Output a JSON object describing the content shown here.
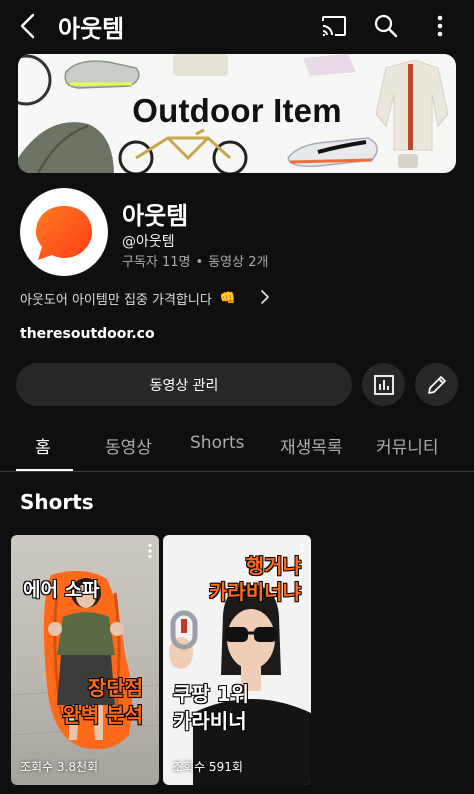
{
  "header": {
    "title": "아웃템"
  },
  "banner": {
    "text": "Outdoor Item"
  },
  "channel": {
    "name": "아웃템",
    "handle": "@아웃템",
    "subscribers": "구독자 11명",
    "separator": "•",
    "videos": "동영상 2개",
    "description": "아웃도어 아이템만 집중 가격합니다",
    "description_emoji": "👊",
    "link": "theresoutdoor.co"
  },
  "actions": {
    "manage_label": "동영상 관리"
  },
  "tabs": [
    {
      "label": "홈",
      "active": true
    },
    {
      "label": "동영상",
      "active": false
    },
    {
      "label": "Shorts",
      "active": false
    },
    {
      "label": "재생목록",
      "active": false
    },
    {
      "label": "커뮤니티",
      "active": false
    }
  ],
  "shorts_section": {
    "title": "Shorts",
    "items": [
      {
        "overlay_top": "에어 소파",
        "overlay_bottom_line1": "장단점",
        "overlay_bottom_line2": "완벽 분석",
        "views": "조회수 3.8천회"
      },
      {
        "overlay_top_line1": "행거냐",
        "overlay_top_line2": "카라비너냐",
        "overlay_bottom_line1": "쿠팡 1위",
        "overlay_bottom_line2": "카라비너",
        "views": "조회수 591회"
      }
    ]
  },
  "colors": {
    "background": "#0f0f0f",
    "surface": "#272727",
    "avatar_orange": "#ff5a1f",
    "overlay_orange": "#ff6a1a",
    "text_secondary": "#aaaaaa"
  }
}
